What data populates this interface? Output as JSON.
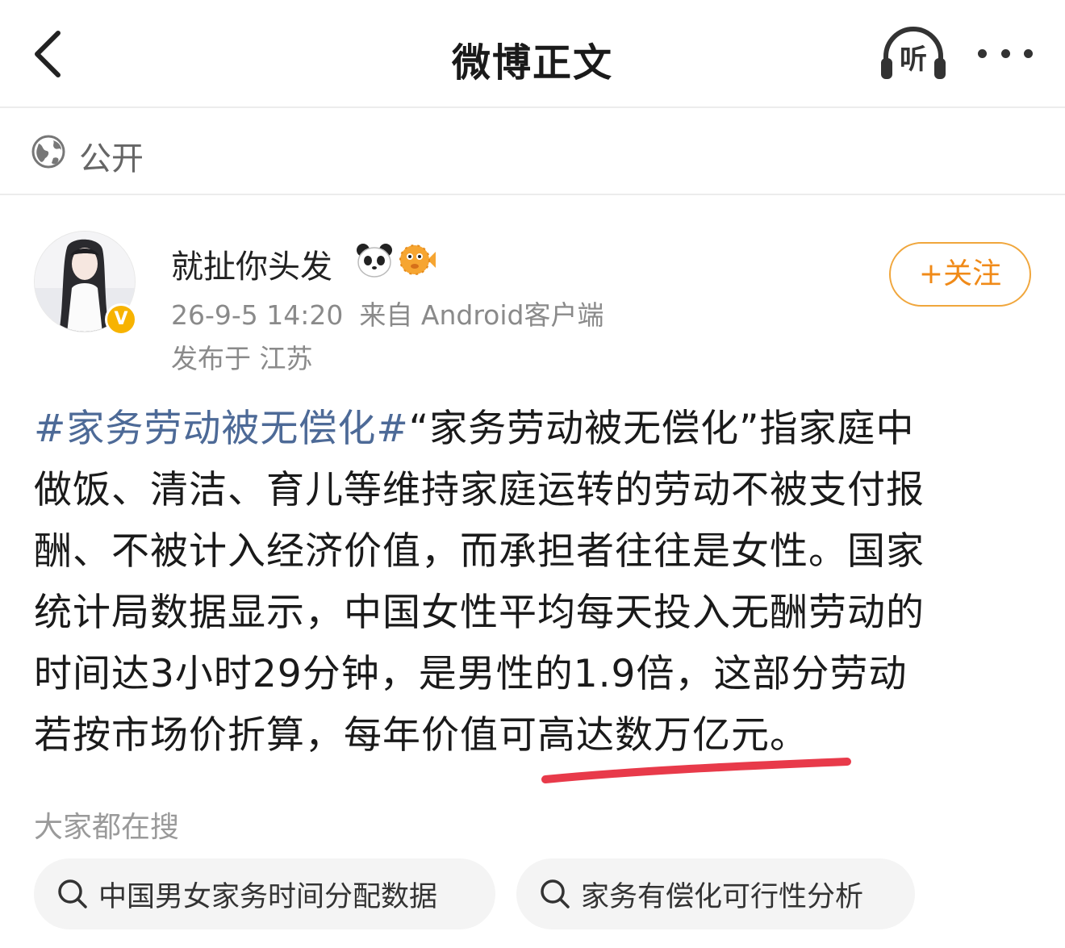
{
  "header": {
    "title": "微博正文",
    "listen_label": "听"
  },
  "visibility": {
    "label": "公开"
  },
  "author": {
    "name": "就扯你头发",
    "verified_badge": "V",
    "date": "26-9-5 14:20",
    "source": "来自 Android客户端",
    "location": "发布于 江苏",
    "follow_label": "+关注"
  },
  "post": {
    "lines": [
      {
        "hashtag": "#家务劳动被无偿化#",
        "text": "“家务劳动被无偿化”指家庭中"
      },
      {
        "text": "做饭、清洁、育儿等维持家庭运转的劳动不被支付报"
      },
      {
        "text": "酬、不被计入经济价值，而承担者往往是女性。国家"
      },
      {
        "text": "统计局数据显示，中国女性平均每天投入无酬劳动的"
      },
      {
        "text": "时间达3小时29分钟，是男性的1.9倍，这部分劳动"
      },
      {
        "text": "若按市场价折算，每年价值可高达数万亿元。"
      }
    ]
  },
  "search": {
    "heading": "大家都在搜",
    "chips": [
      {
        "label": "中国男女家务时间分配数据"
      },
      {
        "label": "家务有偿化可行性分析"
      }
    ]
  },
  "colors": {
    "hashtag": "#4d6a97",
    "follow": "#f08a18",
    "underline": "#e83a4a",
    "badge": "#f7b300"
  }
}
